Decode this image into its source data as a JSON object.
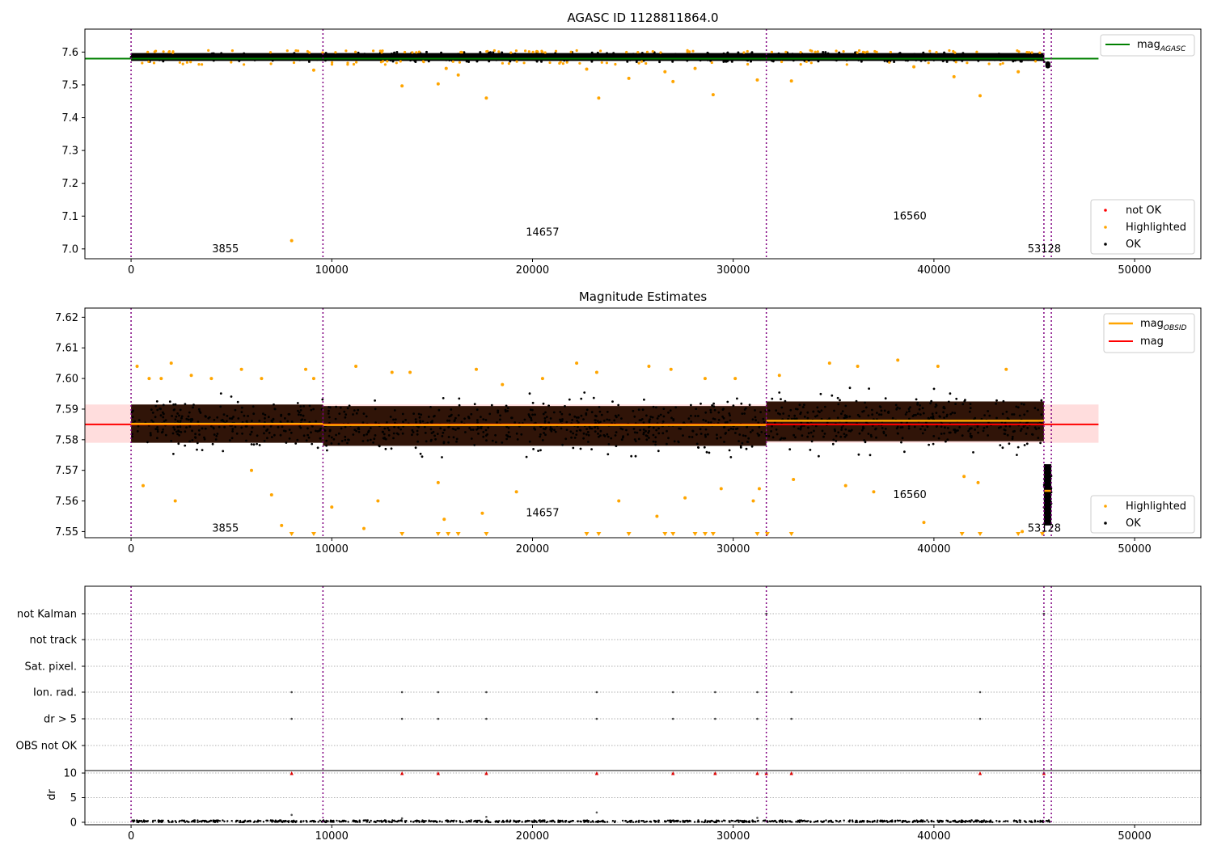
{
  "chart_data": [
    {
      "type": "scatter",
      "title": "AGASC ID 1128811864.0",
      "xlim": [
        -2300,
        53300
      ],
      "ylim": [
        6.97,
        7.67
      ],
      "x_ticks": [
        0,
        10000,
        20000,
        30000,
        40000,
        50000
      ],
      "x_tick_labels": [
        "0",
        "10000",
        "20000",
        "30000",
        "40000",
        "50000"
      ],
      "y_ticks": [
        7.0,
        7.1,
        7.2,
        7.3,
        7.4,
        7.5,
        7.6
      ],
      "y_tick_labels": [
        "7.0",
        "7.1",
        "7.2",
        "7.3",
        "7.4",
        "7.5",
        "7.6"
      ],
      "obs_boundaries": [
        0,
        9560,
        31650,
        45480,
        45850
      ],
      "obsid_labels": [
        {
          "text": "3855",
          "x": 4700,
          "y": 7.0
        },
        {
          "text": "14657",
          "x": 20500,
          "y": 7.05
        },
        {
          "text": "16560",
          "x": 38800,
          "y": 7.1
        },
        {
          "text": "53128",
          "x": 45500,
          "y": 7.0
        }
      ],
      "reference_lines": [
        {
          "name": "mag_AGASC",
          "y": 7.58,
          "x_range": [
            -2300,
            48200
          ],
          "color": "#008000"
        }
      ],
      "ok_band": {
        "y_range": [
          7.573,
          7.597
        ],
        "x_range": [
          0,
          45500
        ],
        "color": "#000000"
      },
      "ok_tail": {
        "x_range": [
          45550,
          45800
        ],
        "y_range": [
          7.55,
          7.572
        ],
        "color": "#000000"
      },
      "highlighted_points": {
        "color": "#ffa500",
        "x": [
          8000,
          9100,
          13500,
          15300,
          15700,
          16300,
          17700,
          22700,
          23300,
          24800,
          26600,
          27000,
          28100,
          29000,
          31200,
          32900,
          39000,
          41000,
          42300,
          44200
        ],
        "y": [
          7.025,
          7.545,
          7.497,
          7.503,
          7.55,
          7.53,
          7.46,
          7.548,
          7.46,
          7.52,
          7.54,
          7.51,
          7.55,
          7.47,
          7.515,
          7.512,
          7.555,
          7.525,
          7.467,
          7.54
        ]
      },
      "legend_upper": [
        "mag_AGASC"
      ],
      "legend_lower": [
        "not OK",
        "Highlighted",
        "OK"
      ],
      "legend_colors": {
        "not OK": "#ff0000",
        "Highlighted": "#ffa500",
        "OK": "#000000"
      },
      "legend_placement_upper": "top-right",
      "legend_placement_lower": "bottom-right"
    },
    {
      "type": "scatter",
      "title": "Magnitude Estimates",
      "xlim": [
        -2300,
        53300
      ],
      "ylim": [
        7.548,
        7.623
      ],
      "x_ticks": [
        0,
        10000,
        20000,
        30000,
        40000,
        50000
      ],
      "x_tick_labels": [
        "0",
        "10000",
        "20000",
        "30000",
        "40000",
        "50000"
      ],
      "y_ticks": [
        7.55,
        7.56,
        7.57,
        7.58,
        7.59,
        7.6,
        7.61,
        7.62
      ],
      "y_tick_labels": [
        "7.55",
        "7.56",
        "7.57",
        "7.58",
        "7.59",
        "7.60",
        "7.61",
        "7.62"
      ],
      "obs_boundaries": [
        0,
        9560,
        31650,
        45480,
        45850
      ],
      "obsid_labels": [
        {
          "text": "3855",
          "x": 4700,
          "y": 7.551
        },
        {
          "text": "14657",
          "x": 20500,
          "y": 7.556
        },
        {
          "text": "16560",
          "x": 38800,
          "y": 7.562
        },
        {
          "text": "53128",
          "x": 45500,
          "y": 7.551
        }
      ],
      "mag_band": {
        "y_range": [
          7.579,
          7.5915
        ],
        "x_range": [
          -2300,
          48200
        ],
        "color": "#ffdddd"
      },
      "mag_line": {
        "name": "mag",
        "y": 7.585,
        "x_range": [
          -2300,
          48200
        ],
        "color": "#ff0000"
      },
      "mag_obsid": {
        "name": "mag_OBSID",
        "color": "#ffa500",
        "segments": [
          {
            "x": [
              0,
              9560
            ],
            "y": 7.5852
          },
          {
            "x": [
              9560,
              31650
            ],
            "y": 7.5848
          },
          {
            "x": [
              31650,
              45480
            ],
            "y": 7.5862
          },
          {
            "x": [
              45480,
              45850
            ],
            "y": 7.5633
          }
        ]
      },
      "ok_clouds": [
        {
          "x": [
            0,
            9560
          ],
          "core": [
            7.579,
            7.5915
          ],
          "spread": [
            7.571,
            7.598
          ]
        },
        {
          "x": [
            9560,
            31650
          ],
          "core": [
            7.578,
            7.591
          ],
          "spread": [
            7.571,
            7.599
          ]
        },
        {
          "x": [
            31650,
            45480
          ],
          "core": [
            7.5795,
            7.5925
          ],
          "spread": [
            7.572,
            7.6
          ]
        },
        {
          "x": [
            45480,
            45850
          ],
          "core": [
            7.552,
            7.572
          ],
          "spread": [
            7.55,
            7.575
          ]
        }
      ],
      "highlighted_points": {
        "color": "#ffa500",
        "x": [
          300,
          600,
          900,
          1500,
          2000,
          2200,
          3000,
          4000,
          5500,
          6000,
          6500,
          7000,
          7500,
          8700,
          9100,
          10000,
          11200,
          11600,
          12300,
          13000,
          13900,
          15300,
          15600,
          17200,
          17500,
          18500,
          19200,
          20500,
          22200,
          23200,
          24300,
          25800,
          26200,
          26900,
          27600,
          28600,
          29400,
          30100,
          31000,
          31300,
          32300,
          33000,
          34800,
          35600,
          36200,
          37000,
          38200,
          39500,
          40200,
          41500,
          42200,
          43600,
          44400
        ],
        "y": [
          7.604,
          7.565,
          7.6,
          7.6,
          7.605,
          7.56,
          7.601,
          7.6,
          7.603,
          7.57,
          7.6,
          7.562,
          7.552,
          7.603,
          7.6,
          7.558,
          7.604,
          7.551,
          7.56,
          7.602,
          7.602,
          7.566,
          7.554,
          7.603,
          7.556,
          7.598,
          7.563,
          7.6,
          7.605,
          7.602,
          7.56,
          7.604,
          7.555,
          7.603,
          7.561,
          7.6,
          7.564,
          7.6,
          7.56,
          7.564,
          7.601,
          7.567,
          7.605,
          7.565,
          7.604,
          7.563,
          7.606,
          7.553,
          7.604,
          7.568,
          7.566,
          7.603,
          7.55
        ]
      },
      "off_scale_markers_x": [
        8000,
        9100,
        13500,
        15300,
        15800,
        16300,
        17700,
        22700,
        23300,
        24800,
        26600,
        27000,
        28100,
        28600,
        29000,
        31200,
        31700,
        32900,
        41400,
        42300,
        44200,
        45400
      ],
      "legend_upper": [
        "mag_OBSID",
        "mag"
      ],
      "legend_lower": [
        "Highlighted",
        "OK"
      ],
      "legend_placement_upper": "top-right",
      "legend_placement_lower": "bottom-right"
    },
    {
      "type": "scatter",
      "title": "",
      "xlim": [
        -2300,
        53300
      ],
      "x_ticks": [
        0,
        10000,
        20000,
        30000,
        40000,
        50000
      ],
      "x_tick_labels": [
        "0",
        "10000",
        "20000",
        "30000",
        "40000",
        "50000"
      ],
      "flag_rows": [
        "not Kalman",
        "not track",
        "Sat. pixel.",
        "Ion. rad.",
        "dr > 5",
        "OBS not OK"
      ],
      "flag_points": {
        "not Kalman": [
          31650,
          45480
        ],
        "not track": [],
        "Sat. pixel.": [],
        "Ion. rad.": [
          8000,
          13500,
          15300,
          17700,
          23200,
          27000,
          29100,
          31200,
          32900,
          42300
        ],
        "dr > 5": [
          8000,
          13500,
          15300,
          17700,
          23200,
          27000,
          29100,
          31200,
          32900,
          42300
        ],
        "OBS not OK": []
      },
      "obs_boundaries": [
        0,
        9560,
        31650,
        45480,
        45850
      ],
      "dr_panel": {
        "ylabel": "dr",
        "ylim": [
          -0.5,
          10.5
        ],
        "y_ticks": [
          0,
          5,
          10
        ],
        "y_tick_labels": [
          "0",
          "5",
          "10"
        ],
        "clipped_markers_x": [
          8000,
          13500,
          15300,
          17700,
          23200,
          27000,
          29100,
          31200,
          31650,
          32900,
          42300,
          45480
        ],
        "outlier_points": [
          {
            "x": 8000,
            "y": 1.5
          },
          {
            "x": 13500,
            "y": 0.8
          },
          {
            "x": 17700,
            "y": 1.1
          },
          {
            "x": 23200,
            "y": 2.0
          },
          {
            "x": 31200,
            "y": 0.9
          }
        ],
        "baseline_y_range": [
          0.0,
          0.4
        ]
      }
    }
  ]
}
